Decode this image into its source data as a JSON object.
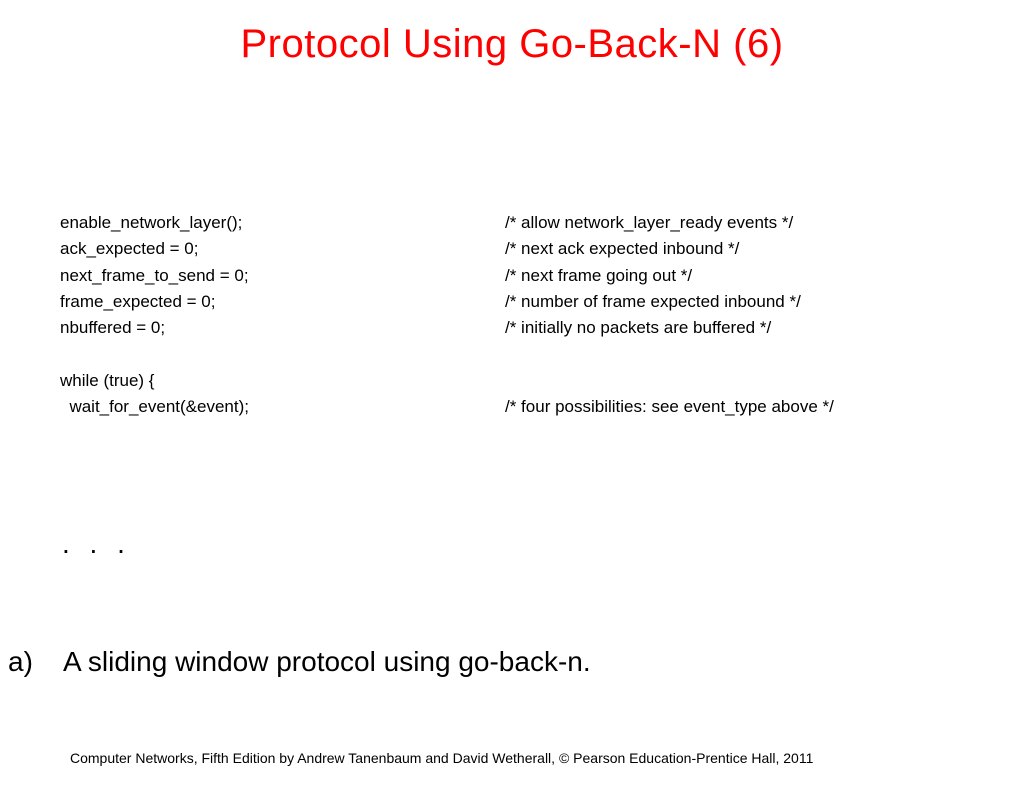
{
  "title": "Protocol Using Go-Back-N (6)",
  "code": {
    "rows": [
      {
        "left": "enable_network_layer();",
        "right": "/* allow network_layer_ready events */"
      },
      {
        "left": "ack_expected = 0;",
        "right": "/* next ack expected inbound */"
      },
      {
        "left": "next_frame_to_send = 0;",
        "right": "/* next frame going out */"
      },
      {
        "left": "frame_expected = 0;",
        "right": "/* number of frame expected inbound */"
      },
      {
        "left": "nbuffered = 0;",
        "right": "/* initially no packets are buffered */"
      }
    ],
    "rows2": [
      {
        "left": "while (true) {",
        "right": ""
      },
      {
        "left": "  wait_for_event(&event);",
        "right": "/* four possibilities: see event_type above */"
      }
    ]
  },
  "ellipsis": ". . .",
  "caption": {
    "letter": "a)",
    "text": "A sliding window protocol using go-back-n."
  },
  "footer": "Computer Networks, Fifth Edition by Andrew Tanenbaum and David Wetherall, © Pearson Education-Prentice Hall, 2011"
}
